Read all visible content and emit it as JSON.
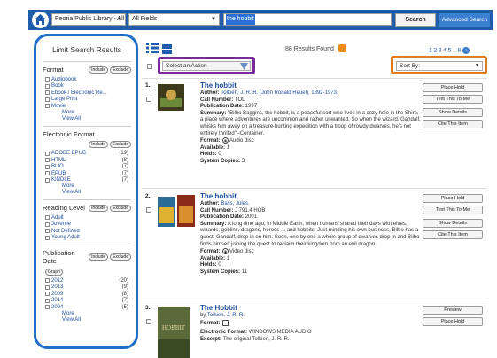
{
  "header": {
    "library_select": "Peoria Public Library - All",
    "field_select": "All Fields",
    "search_value": "the hobbit",
    "search_label": "Search",
    "advanced_label": "Advanced Search"
  },
  "sidebar": {
    "title": "Limit Search Results",
    "include_label": "Include",
    "exclude_label": "Exclude",
    "more_label": "More",
    "view_all_label": "View All",
    "graph_label": "Graph",
    "format": {
      "heading": "Format",
      "options": [
        "Audiobook",
        "Book",
        "Ebook / Electronic Re...",
        "Large Print",
        "Movie"
      ]
    },
    "electronic_format": {
      "heading": "Electronic Format",
      "options": [
        {
          "label": "ADOBE EPUB",
          "count": "(19)"
        },
        {
          "label": "HTML",
          "count": "(8)"
        },
        {
          "label": "BLIO",
          "count": "(7)"
        },
        {
          "label": "EPUB",
          "count": "(7)"
        },
        {
          "label": "KINDLE",
          "count": "(7)"
        }
      ]
    },
    "reading_level": {
      "heading": "Reading Level",
      "options": [
        "Adult",
        "Juvenile",
        "Not Defined",
        "Young Adult"
      ]
    },
    "publication_date": {
      "heading": "Publication Date",
      "options": [
        {
          "label": "2012",
          "count": "(20)"
        },
        {
          "label": "2013",
          "count": "(9)"
        },
        {
          "label": "2009",
          "count": "(8)"
        },
        {
          "label": "2014",
          "count": "(7)"
        },
        {
          "label": "2004",
          "count": "(5)"
        }
      ]
    }
  },
  "toolbar": {
    "results_found": "88 Results Found",
    "pages": "1 2 3 4 5 .. 8",
    "current_page": "1",
    "action_select": "Select an Action",
    "sort_select": "Sort By:"
  },
  "labels": {
    "author": "Author:",
    "call_number": "Call Number:",
    "publication_date": "Publication Date:",
    "summary": "Summary:",
    "format": "Format:",
    "available": "Available:",
    "holds": "Holds:",
    "system_copies": "System Copies:",
    "electronic_format": "Electronic Format:",
    "excerpt": "Excerpt:"
  },
  "results": [
    {
      "num": "1.",
      "title": "The hobbit",
      "author": "Tolkien, J. R. R. (John Ronald Reuel), 1892-1973.",
      "call_number": "TOL",
      "publication_date": "1997",
      "summary": "\"Bilbo Baggins, the hobbit, is a peaceful sort who lives in a cozy hole in the Shire, a place where adventures are uncommon and rather unwanted. So when the wizard, Gandalf, whisks him away on a treasure-hunting expedition with a troop of rowdy dwarves, he's not entirely thrilled\"--Container.",
      "format": "Audio disc",
      "available": "1",
      "holds": "0",
      "system_copies": "3",
      "actions": [
        "Place Hold",
        "Text This To Me",
        "Show Details",
        "Cite This Item"
      ]
    },
    {
      "num": "2.",
      "title": "The hobbit",
      "author": "Bass, Jules.",
      "call_number": "J 791.4 HOB",
      "publication_date": "2001",
      "summary": "A long time ago, in Middle Earth, when humans shared their days with elves, wizards, goblins, dragons, heroes ... and hobbits. Just minding his own business, Bilbo has a guest, Gandalf, drop in on him. Soon, one by one a whole group of dwarves drop in and Bilbo finds himself joining the quest to reclaim their kingdom from an evil dragon.",
      "format": "Video disc",
      "available": "1",
      "holds": "0",
      "system_copies": "11",
      "actions": [
        "Place Hold",
        "Text This To Me",
        "Show Details",
        "Cite This Item"
      ]
    },
    {
      "num": "3.",
      "title": "The Hobbit",
      "author": "Tolkien, J. R. R.",
      "electronic_format": "WINDOWS MEDIA AUDIO",
      "excerpt": "The original Tolkien, J. R. R.",
      "actions": [
        "Preview",
        "Place Hold"
      ]
    }
  ]
}
